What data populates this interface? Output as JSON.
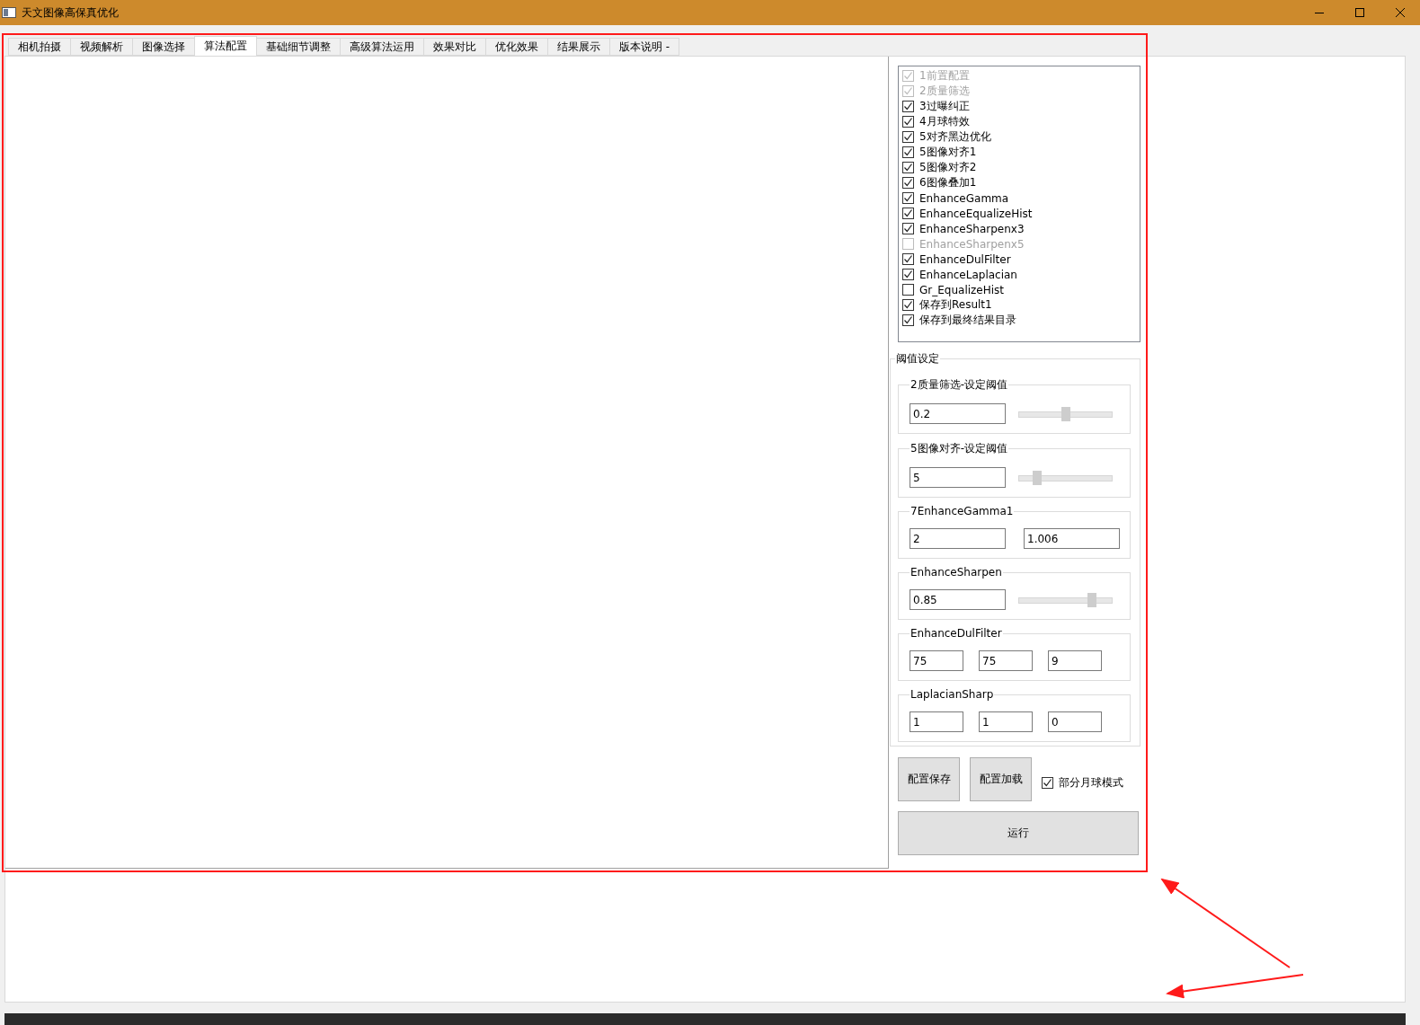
{
  "window": {
    "title": "天文图像高保真优化"
  },
  "tabs": [
    {
      "label": "相机拍摄",
      "selected": false
    },
    {
      "label": "视频解析",
      "selected": false
    },
    {
      "label": "图像选择",
      "selected": false
    },
    {
      "label": "算法配置",
      "selected": true
    },
    {
      "label": "基础细节调整",
      "selected": false
    },
    {
      "label": "高级算法运用",
      "selected": false
    },
    {
      "label": "效果对比",
      "selected": false
    },
    {
      "label": "优化效果",
      "selected": false
    },
    {
      "label": "结果展示",
      "selected": false
    },
    {
      "label": "版本说明 -",
      "selected": false
    }
  ],
  "steps": [
    {
      "label": "1前置配置",
      "checked": true,
      "disabled": true
    },
    {
      "label": "2质量筛选",
      "checked": true,
      "disabled": true
    },
    {
      "label": "3过曝纠正",
      "checked": true,
      "disabled": false
    },
    {
      "label": "4月球特效",
      "checked": true,
      "disabled": false
    },
    {
      "label": "5对齐黑边优化",
      "checked": true,
      "disabled": false
    },
    {
      "label": "5图像对齐1",
      "checked": true,
      "disabled": false
    },
    {
      "label": "5图像对齐2",
      "checked": true,
      "disabled": false
    },
    {
      "label": "6图像叠加1",
      "checked": true,
      "disabled": false
    },
    {
      "label": "EnhanceGamma",
      "checked": true,
      "disabled": false
    },
    {
      "label": "EnhanceEqualizeHist",
      "checked": true,
      "disabled": false
    },
    {
      "label": "EnhanceSharpenx3",
      "checked": true,
      "disabled": false
    },
    {
      "label": "EnhanceSharpenx5",
      "checked": false,
      "disabled": true
    },
    {
      "label": "EnhanceDulFilter",
      "checked": true,
      "disabled": false
    },
    {
      "label": "EnhanceLaplacian",
      "checked": true,
      "disabled": false
    },
    {
      "label": "Gr_EqualizeHist",
      "checked": false,
      "disabled": false
    },
    {
      "label": "保存到Result1",
      "checked": true,
      "disabled": false
    },
    {
      "label": "保存到最终结果目录",
      "checked": true,
      "disabled": false
    }
  ],
  "thresholds": {
    "title": "阈值设定",
    "groups": [
      {
        "title": "2质量筛选-设定阈值",
        "kind": "slider",
        "values": [
          "0.2"
        ],
        "level": 0.5
      },
      {
        "title": "5图像对齐-设定阈值",
        "kind": "slider",
        "values": [
          "5"
        ],
        "level": 0.17
      },
      {
        "title": "7EnhanceGamma1",
        "kind": "fields",
        "values": [
          "2",
          "1.006"
        ]
      },
      {
        "title": "EnhanceSharpen",
        "kind": "slider",
        "values": [
          "0.85"
        ],
        "level": 0.81
      },
      {
        "title": "EnhanceDulFilter",
        "kind": "fields",
        "values": [
          "75",
          "75",
          "9"
        ]
      },
      {
        "title": "LaplacianSharp",
        "kind": "fields",
        "values": [
          "1",
          "1",
          "0"
        ]
      }
    ]
  },
  "buttons": [
    "配置保存",
    "配置加载"
  ],
  "moon_mode": {
    "label": "部分月球模式",
    "checked": true
  },
  "run_button": "运行"
}
